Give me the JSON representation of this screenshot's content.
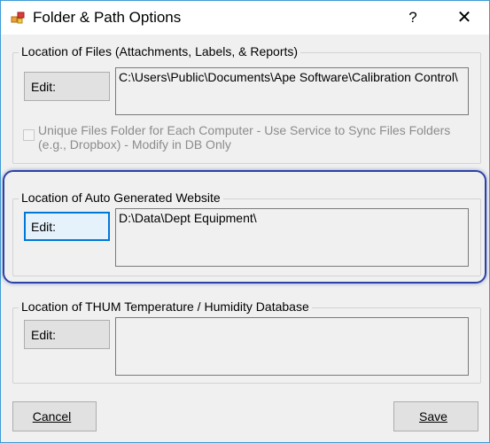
{
  "window": {
    "title": "Folder & Path Options",
    "help": "?",
    "close": "✕"
  },
  "files_group": {
    "label": "Location of Files (Attachments, Labels, & Reports)",
    "edit_label": "Edit:",
    "path": "C:\\Users\\Public\\Documents\\Ape Software\\Calibration Control\\",
    "checkbox_checked": false,
    "checkbox_label": "Unique Files Folder for Each Computer - Use Service to Sync Files Folders (e.g., Dropbox) - Modify in DB Only"
  },
  "website_group": {
    "label": "Location of Auto Generated Website",
    "edit_label": "Edit:",
    "path": "D:\\Data\\Dept Equipment\\"
  },
  "thum_group": {
    "label": "Location of THUM Temperature / Humidity Database",
    "edit_label": "Edit:",
    "path": ""
  },
  "footer": {
    "cancel_label": "Cancel",
    "save_label": "Save"
  },
  "colors": {
    "highlight_outline": "#2b43a6",
    "window_border": "#3c9bd6"
  }
}
